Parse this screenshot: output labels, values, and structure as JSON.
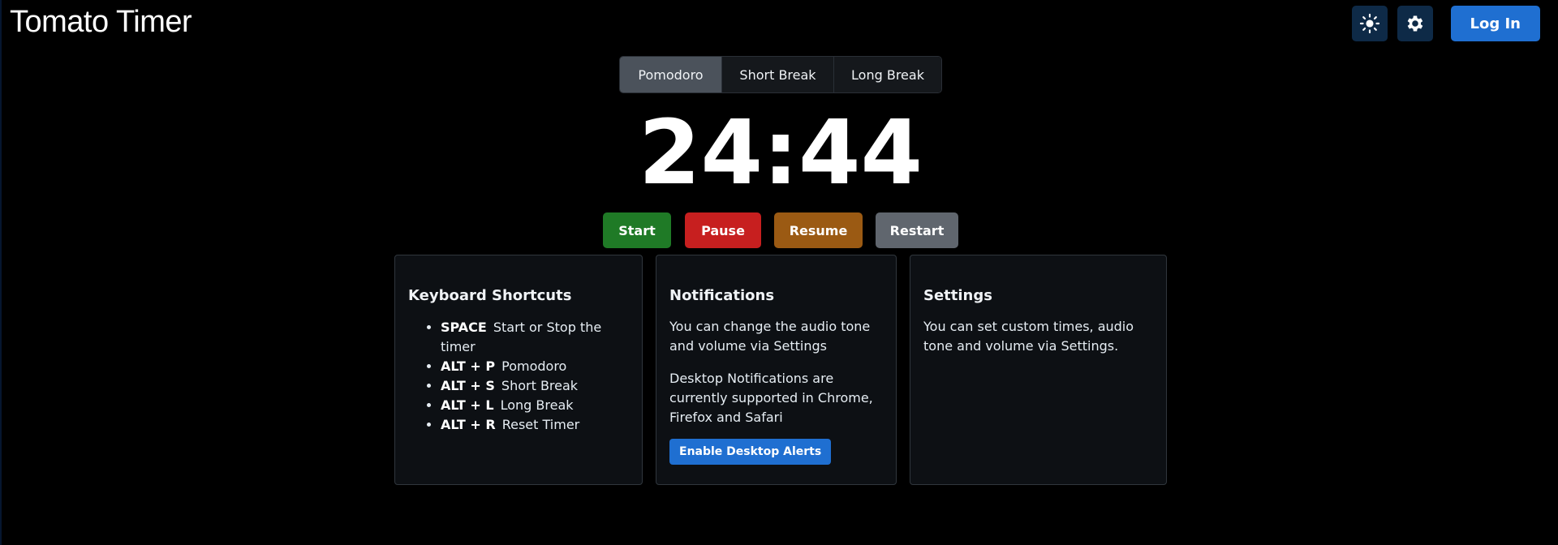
{
  "header": {
    "title": "Tomato Timer",
    "theme_icon": "sun-icon",
    "settings_icon": "gear-icon",
    "login_label": "Log In"
  },
  "modes": {
    "tabs": [
      {
        "label": "Pomodoro",
        "active": true
      },
      {
        "label": "Short Break",
        "active": false
      },
      {
        "label": "Long Break",
        "active": false
      }
    ]
  },
  "timer": {
    "display": "24:44"
  },
  "controls": {
    "start": "Start",
    "pause": "Pause",
    "resume": "Resume",
    "restart": "Restart"
  },
  "cards": {
    "shortcuts": {
      "title": "Keyboard Shortcuts",
      "items": [
        {
          "key": "SPACE",
          "desc": "Start or Stop the timer"
        },
        {
          "key": "ALT + P",
          "desc": "Pomodoro"
        },
        {
          "key": "ALT + S",
          "desc": "Short Break"
        },
        {
          "key": "ALT + L",
          "desc": "Long Break"
        },
        {
          "key": "ALT + R",
          "desc": "Reset Timer"
        }
      ]
    },
    "notifications": {
      "title": "Notifications",
      "text1": "You can change the audio tone and volume via Settings",
      "text2": "Desktop Notifications are currently supported in Chrome, Firefox and Safari",
      "button_label": "Enable Desktop Alerts"
    },
    "settings": {
      "title": "Settings",
      "text": "You can set custom times, audio tone and volume via Settings."
    }
  },
  "colors": {
    "background": "#000000",
    "start": "#1f7a26",
    "pause": "#c71f1f",
    "resume": "#9b5a13",
    "restart": "#60666e",
    "primary": "#1f6fd1"
  }
}
